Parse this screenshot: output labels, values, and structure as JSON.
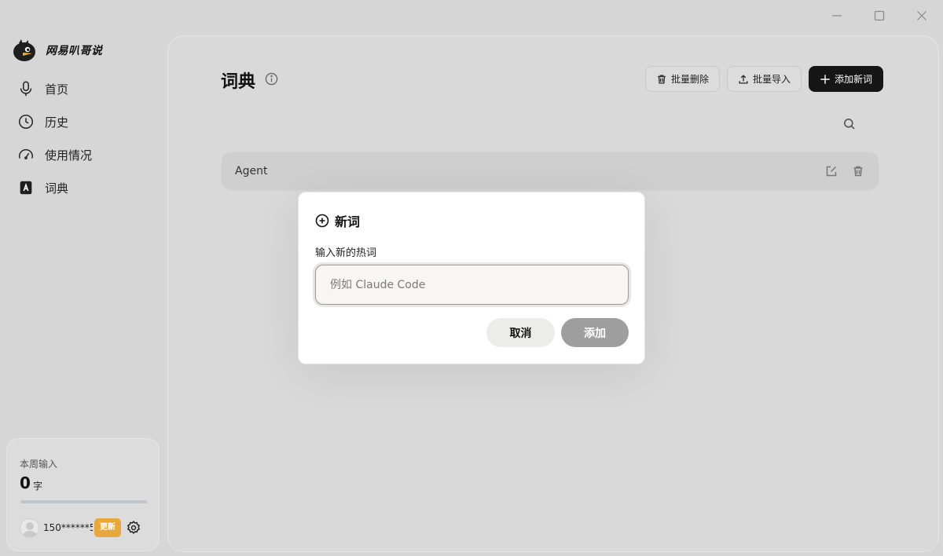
{
  "window": {
    "controls": [
      "minimize",
      "maximize",
      "close"
    ]
  },
  "brand": {
    "name": "网易叭哥说",
    "logo": "bird-logo"
  },
  "sidebar": {
    "items": [
      {
        "label": "首页",
        "icon": "microphone-icon"
      },
      {
        "label": "历史",
        "icon": "clock-icon"
      },
      {
        "label": "使用情况",
        "icon": "gauge-icon"
      },
      {
        "label": "词典",
        "icon": "dictionary-icon",
        "active": true
      }
    ],
    "stats": {
      "title": "本周输入",
      "value": "0",
      "unit": "字",
      "progress": 0
    },
    "user": {
      "phone": "150******5",
      "update_label": "更新",
      "settings_icon": "gear-icon"
    }
  },
  "main": {
    "title": "词典",
    "toolbar": {
      "batch_delete": "批量删除",
      "batch_import": "批量导入",
      "add_word": "添加新词"
    },
    "words": [
      {
        "text": "Agent"
      }
    ]
  },
  "modal": {
    "title": "新词",
    "field_label": "输入新的热词",
    "input_value": "",
    "input_placeholder": "例如 Claude Code",
    "cancel_label": "取消",
    "add_label": "添加"
  },
  "colors": {
    "accent_dark": "#161616",
    "update_badge": "#e8a73a",
    "disabled_button": "#9e9e9e"
  }
}
